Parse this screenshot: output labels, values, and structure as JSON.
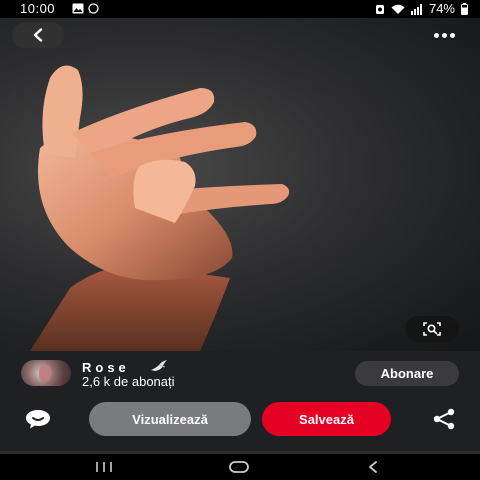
{
  "status_bar": {
    "time": "10:00",
    "battery": "74%",
    "icons": [
      "image-icon",
      "whatsapp-icon",
      "battery-saver-icon",
      "wifi-icon",
      "signal-icon",
      "battery-icon"
    ]
  },
  "viewer": {
    "back_icon": "chevron-left-icon",
    "more_icon": "more-horizontal-icon",
    "lens_icon": "visual-search-icon"
  },
  "profile": {
    "name": "Rose",
    "name_emoji_icon": "bird-icon",
    "followers": "2,6 k de abonați",
    "follow_label": "Abonare"
  },
  "actions": {
    "comment_icon": "comment-icon",
    "view_label": "Vizualizează",
    "save_label": "Salvează",
    "share_icon": "share-icon"
  },
  "colors": {
    "save": "#e60023",
    "view": "#7a7b7e",
    "follow": "#3b3b3f",
    "panel": "#1f2024"
  },
  "nav_bar": {
    "icons": [
      "recent-apps-icon",
      "home-icon",
      "back-icon"
    ]
  }
}
